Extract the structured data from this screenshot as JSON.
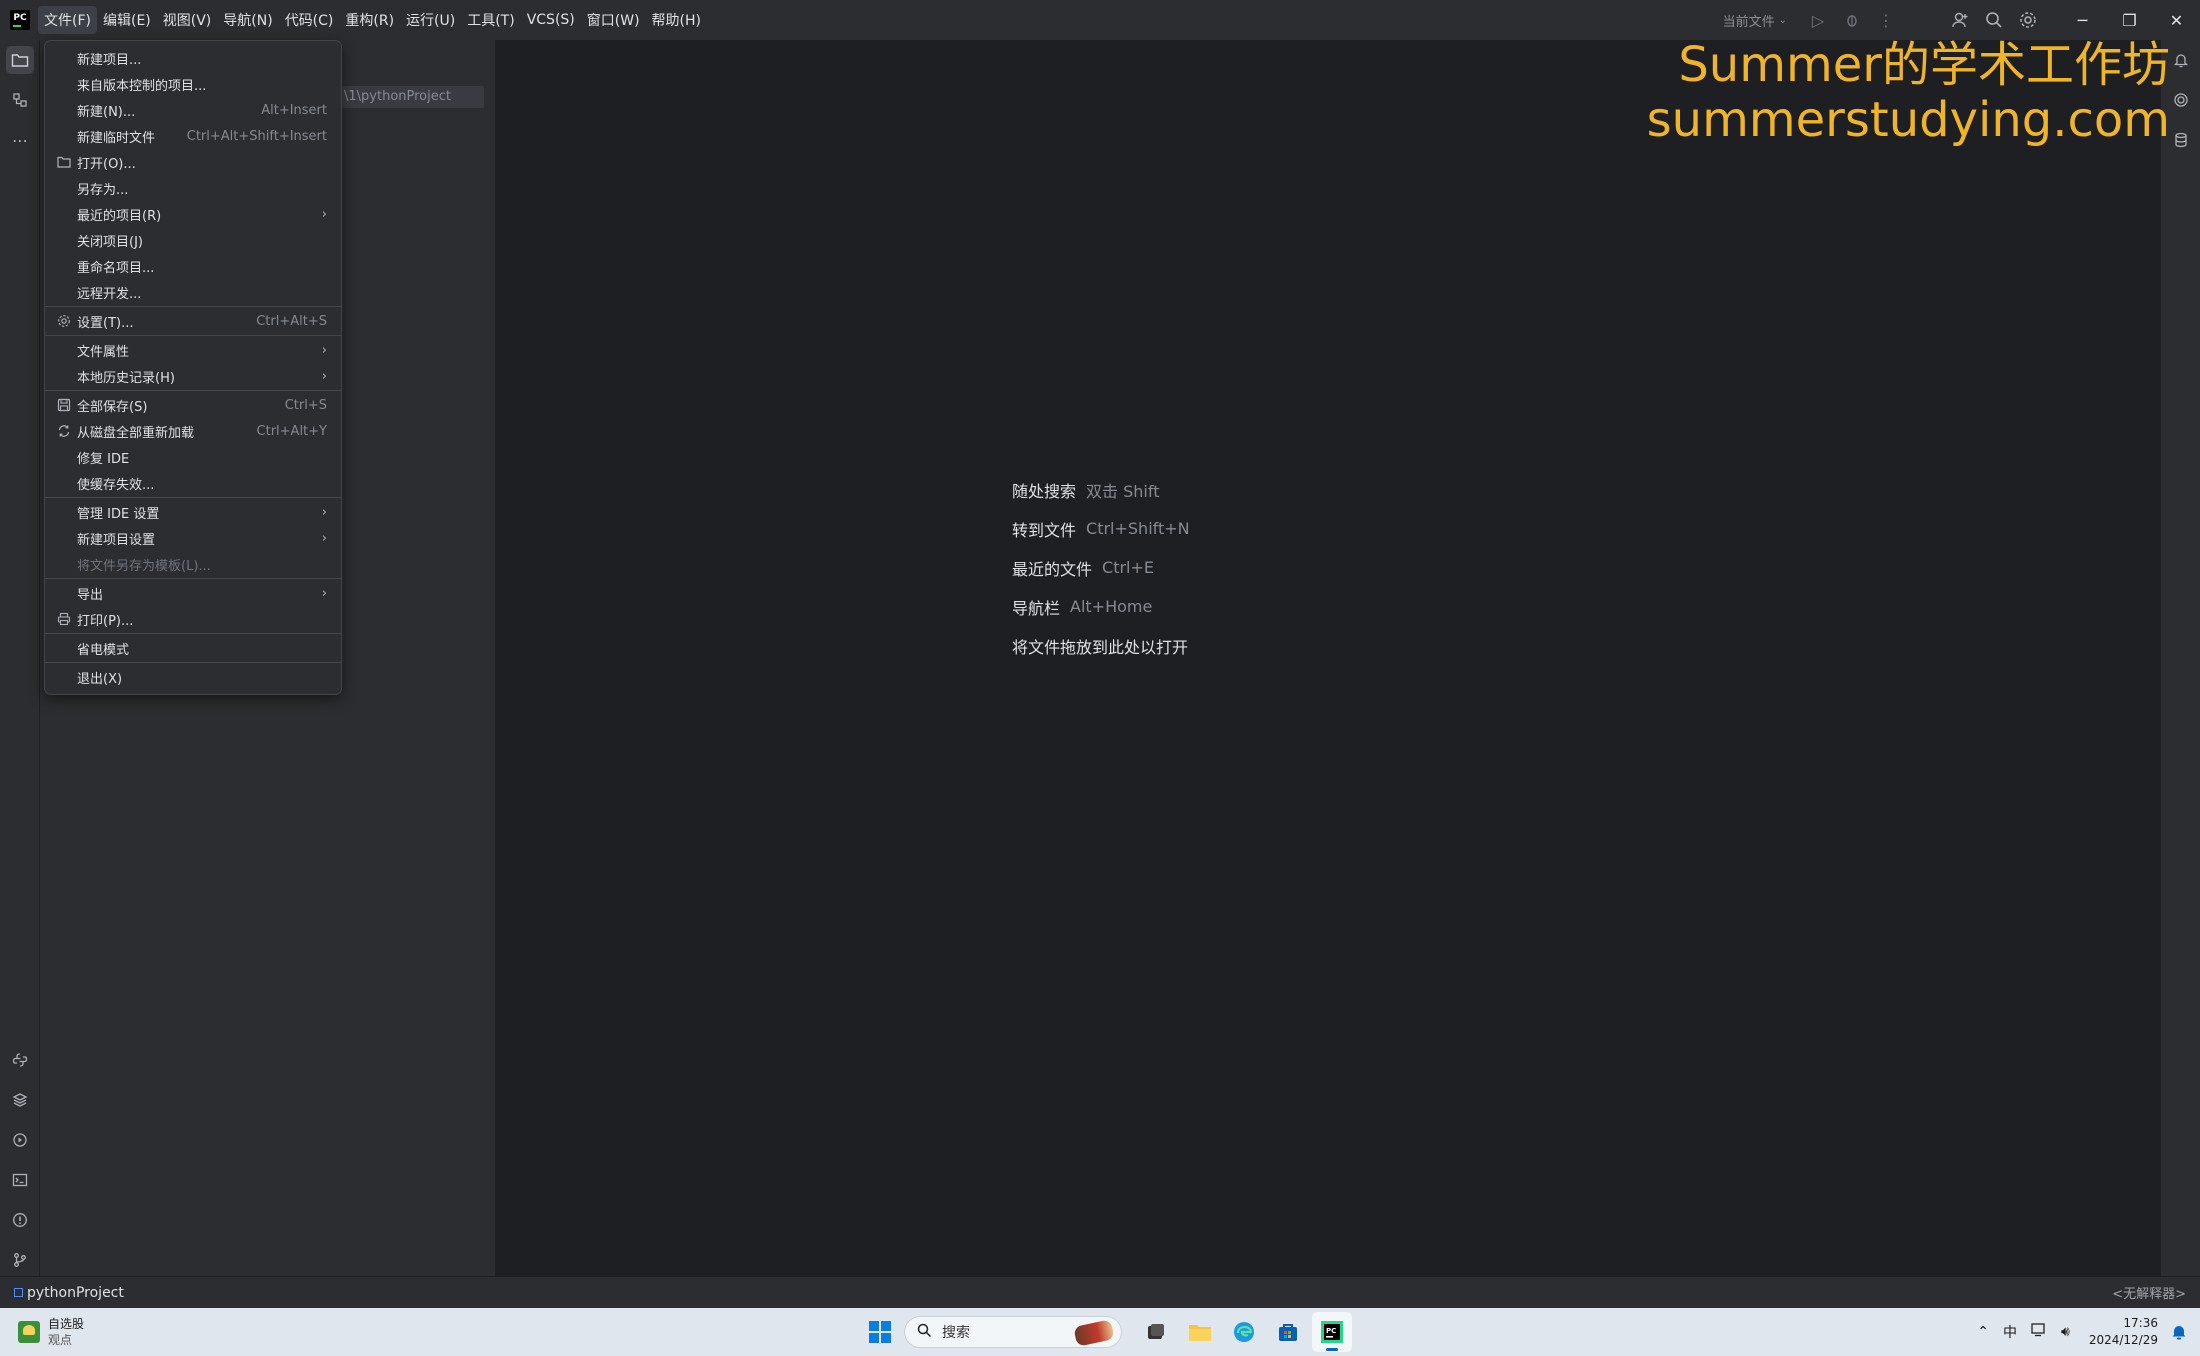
{
  "titlebar": {
    "menus": [
      "文件(F)",
      "编辑(E)",
      "视图(V)",
      "导航(N)",
      "代码(C)",
      "重构(R)",
      "运行(U)",
      "工具(T)",
      "VCS(S)",
      "窗口(W)",
      "帮助(H)"
    ],
    "current_file_label": "当前文件"
  },
  "file_menu": {
    "items": [
      {
        "label": "新建项目...",
        "shortcut": "",
        "icon": ""
      },
      {
        "label": "来自版本控制的项目...",
        "shortcut": "",
        "icon": ""
      },
      {
        "label": "新建(N)...",
        "shortcut": "Alt+Insert",
        "icon": ""
      },
      {
        "label": "新建临时文件",
        "shortcut": "Ctrl+Alt+Shift+Insert",
        "icon": ""
      },
      {
        "label": "打开(O)...",
        "shortcut": "",
        "icon": "folder-icon"
      },
      {
        "label": "另存为...",
        "shortcut": "",
        "icon": ""
      },
      {
        "label": "最近的项目(R)",
        "shortcut": "",
        "icon": "",
        "submenu": true
      },
      {
        "label": "关闭项目(J)",
        "shortcut": "",
        "icon": ""
      },
      {
        "label": "重命名项目...",
        "shortcut": "",
        "icon": ""
      },
      {
        "label": "远程开发...",
        "shortcut": "",
        "icon": ""
      },
      {
        "label": "设置(T)...",
        "shortcut": "Ctrl+Alt+S",
        "icon": "gear-icon"
      },
      {
        "label": "文件属性",
        "shortcut": "",
        "icon": "",
        "submenu": true
      },
      {
        "label": "本地历史记录(H)",
        "shortcut": "",
        "icon": "",
        "submenu": true
      },
      {
        "label": "全部保存(S)",
        "shortcut": "Ctrl+S",
        "icon": "save-icon"
      },
      {
        "label": "从磁盘全部重新加载",
        "shortcut": "Ctrl+Alt+Y",
        "icon": "reload-icon"
      },
      {
        "label": "修复 IDE",
        "shortcut": "",
        "icon": ""
      },
      {
        "label": "使缓存失效...",
        "shortcut": "",
        "icon": ""
      },
      {
        "label": "管理 IDE 设置",
        "shortcut": "",
        "icon": "",
        "submenu": true
      },
      {
        "label": "新建项目设置",
        "shortcut": "",
        "icon": "",
        "submenu": true
      },
      {
        "label": "将文件另存为模板(L)...",
        "shortcut": "",
        "icon": "",
        "disabled": true
      },
      {
        "label": "导出",
        "shortcut": "",
        "icon": "",
        "submenu": true
      },
      {
        "label": "打印(P)...",
        "shortcut": "",
        "icon": "print-icon"
      },
      {
        "label": "省电模式",
        "shortcut": "",
        "icon": ""
      },
      {
        "label": "退出(X)",
        "shortcut": "",
        "icon": ""
      }
    ]
  },
  "project_panel": {
    "path_fragment": "\\1\\pythonProject"
  },
  "editor_hints": [
    {
      "label": "随处搜索",
      "key": "双击 Shift"
    },
    {
      "label": "转到文件",
      "key": "Ctrl+Shift+N"
    },
    {
      "label": "最近的文件",
      "key": "Ctrl+E"
    },
    {
      "label": "导航栏",
      "key": "Alt+Home"
    },
    {
      "label": "将文件拖放到此处以打开",
      "key": ""
    }
  ],
  "watermark": {
    "line1": "Summer的学术工作坊",
    "line2": "summerstudying.com"
  },
  "statusbar": {
    "project_name": "pythonProject",
    "interpreter": "<无解释器>"
  },
  "taskbar": {
    "widget_title": "自选股",
    "widget_sub": "观点",
    "search_placeholder": "搜索",
    "ime": "中",
    "time": "17:36",
    "date": "2024/12/29"
  },
  "colors": {
    "accent_watermark": "#f0b429",
    "ide_bg": "#1e1f22",
    "panel_bg": "#2b2d30"
  }
}
